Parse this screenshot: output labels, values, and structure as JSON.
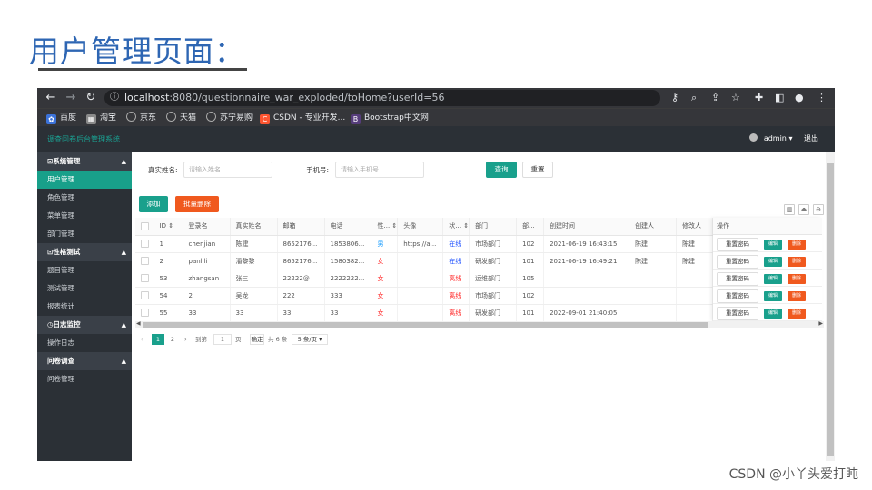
{
  "slide": {
    "title": "用户管理页面：",
    "watermark": "CSDN @小丫头爱打盹"
  },
  "browser": {
    "url_host": "localhost",
    "url_rest": ":8080/questionnaire_war_exploded/toHome?userId=56",
    "bookmarks": [
      {
        "label": "百度",
        "color": "#3b72d9",
        "icon": "baidu-icon"
      },
      {
        "label": "淘宝",
        "color": "#8a8a8a",
        "icon": "taobao-icon"
      },
      {
        "label": "京东",
        "color": "#5f6368",
        "icon": "globe-icon"
      },
      {
        "label": "天猫",
        "color": "#5f6368",
        "icon": "globe-icon"
      },
      {
        "label": "苏宁易购",
        "color": "#5f6368",
        "icon": "globe-icon"
      },
      {
        "label": "CSDN - 专业开发...",
        "color": "#fc5531",
        "icon": "csdn-icon",
        "glyph": "C"
      },
      {
        "label": "Bootstrap中文网",
        "color": "#563d7c",
        "icon": "bootstrap-icon",
        "glyph": "B"
      }
    ]
  },
  "app": {
    "logo": "调查问卷后台管理系统",
    "user": "admin",
    "logout": "退出"
  },
  "sidebar": {
    "groups": [
      {
        "label": "⊡系统管理",
        "items": [
          "用户管理",
          "角色管理",
          "菜单管理",
          "部门管理"
        ]
      },
      {
        "label": "⊡性格测试",
        "items": [
          "题目管理",
          "测试管理",
          "报表统计"
        ]
      },
      {
        "label": "◷日志监控",
        "items": [
          "操作日志"
        ]
      },
      {
        "label": "问卷调查",
        "items": [
          "问卷管理"
        ]
      }
    ],
    "active": "用户管理"
  },
  "search": {
    "name_label": "真实姓名:",
    "name_placeholder": "请输入姓名",
    "phone_label": "手机号:",
    "phone_placeholder": "请输入手机号",
    "query": "查询",
    "reset": "重置"
  },
  "toolbar": {
    "add": "添加",
    "batch_delete": "批量删除"
  },
  "table": {
    "headers": [
      "ID",
      "登录名",
      "真实姓名",
      "邮箱",
      "电话",
      "性...",
      "头像",
      "状...",
      "部门",
      "部...",
      "创建时间",
      "创建人",
      "修改人"
    ],
    "rows": [
      {
        "id": "1",
        "login": "chenjian",
        "name": "陈建",
        "email": "8652176...",
        "phone": "1853806...",
        "sex": "男",
        "avatar": "https://a...",
        "status": "在线",
        "dept": "市场部门",
        "deptno": "102",
        "created": "2021-06-19 16:43:15",
        "creator": "陈建",
        "modifier": "陈建"
      },
      {
        "id": "2",
        "login": "panlili",
        "name": "潘黎黎",
        "email": "8652176...",
        "phone": "1580382...",
        "sex": "女",
        "avatar": "",
        "status": "在线",
        "dept": "研发部门",
        "deptno": "101",
        "created": "2021-06-19 16:49:21",
        "creator": "陈建",
        "modifier": "陈建"
      },
      {
        "id": "53",
        "login": "zhangsan",
        "name": "张三",
        "email": "22222@",
        "phone": "2222222...",
        "sex": "女",
        "avatar": "",
        "status": "离线",
        "dept": "运维部门",
        "deptno": "105",
        "created": "",
        "creator": "",
        "modifier": ""
      },
      {
        "id": "54",
        "login": "2",
        "name": "吴龙",
        "email": "222",
        "phone": "333",
        "sex": "女",
        "avatar": "",
        "status": "离线",
        "dept": "市场部门",
        "deptno": "102",
        "created": "",
        "creator": "",
        "modifier": ""
      },
      {
        "id": "55",
        "login": "33",
        "name": "33",
        "email": "33",
        "phone": "33",
        "sex": "女",
        "avatar": "",
        "status": "离线",
        "dept": "研发部门",
        "deptno": "101",
        "created": "2022-09-01 21:40:05",
        "creator": "",
        "modifier": ""
      }
    ],
    "op_header": "操作",
    "op_reset": "重置密码",
    "op_edit": "编辑",
    "op_delete": "删除"
  },
  "pager": {
    "pages": [
      "1",
      "2"
    ],
    "goto": "到第",
    "page_input": "1",
    "page_unit": "页",
    "confirm": "确定",
    "total": "共 6 条",
    "per_page": "5 条/页"
  }
}
